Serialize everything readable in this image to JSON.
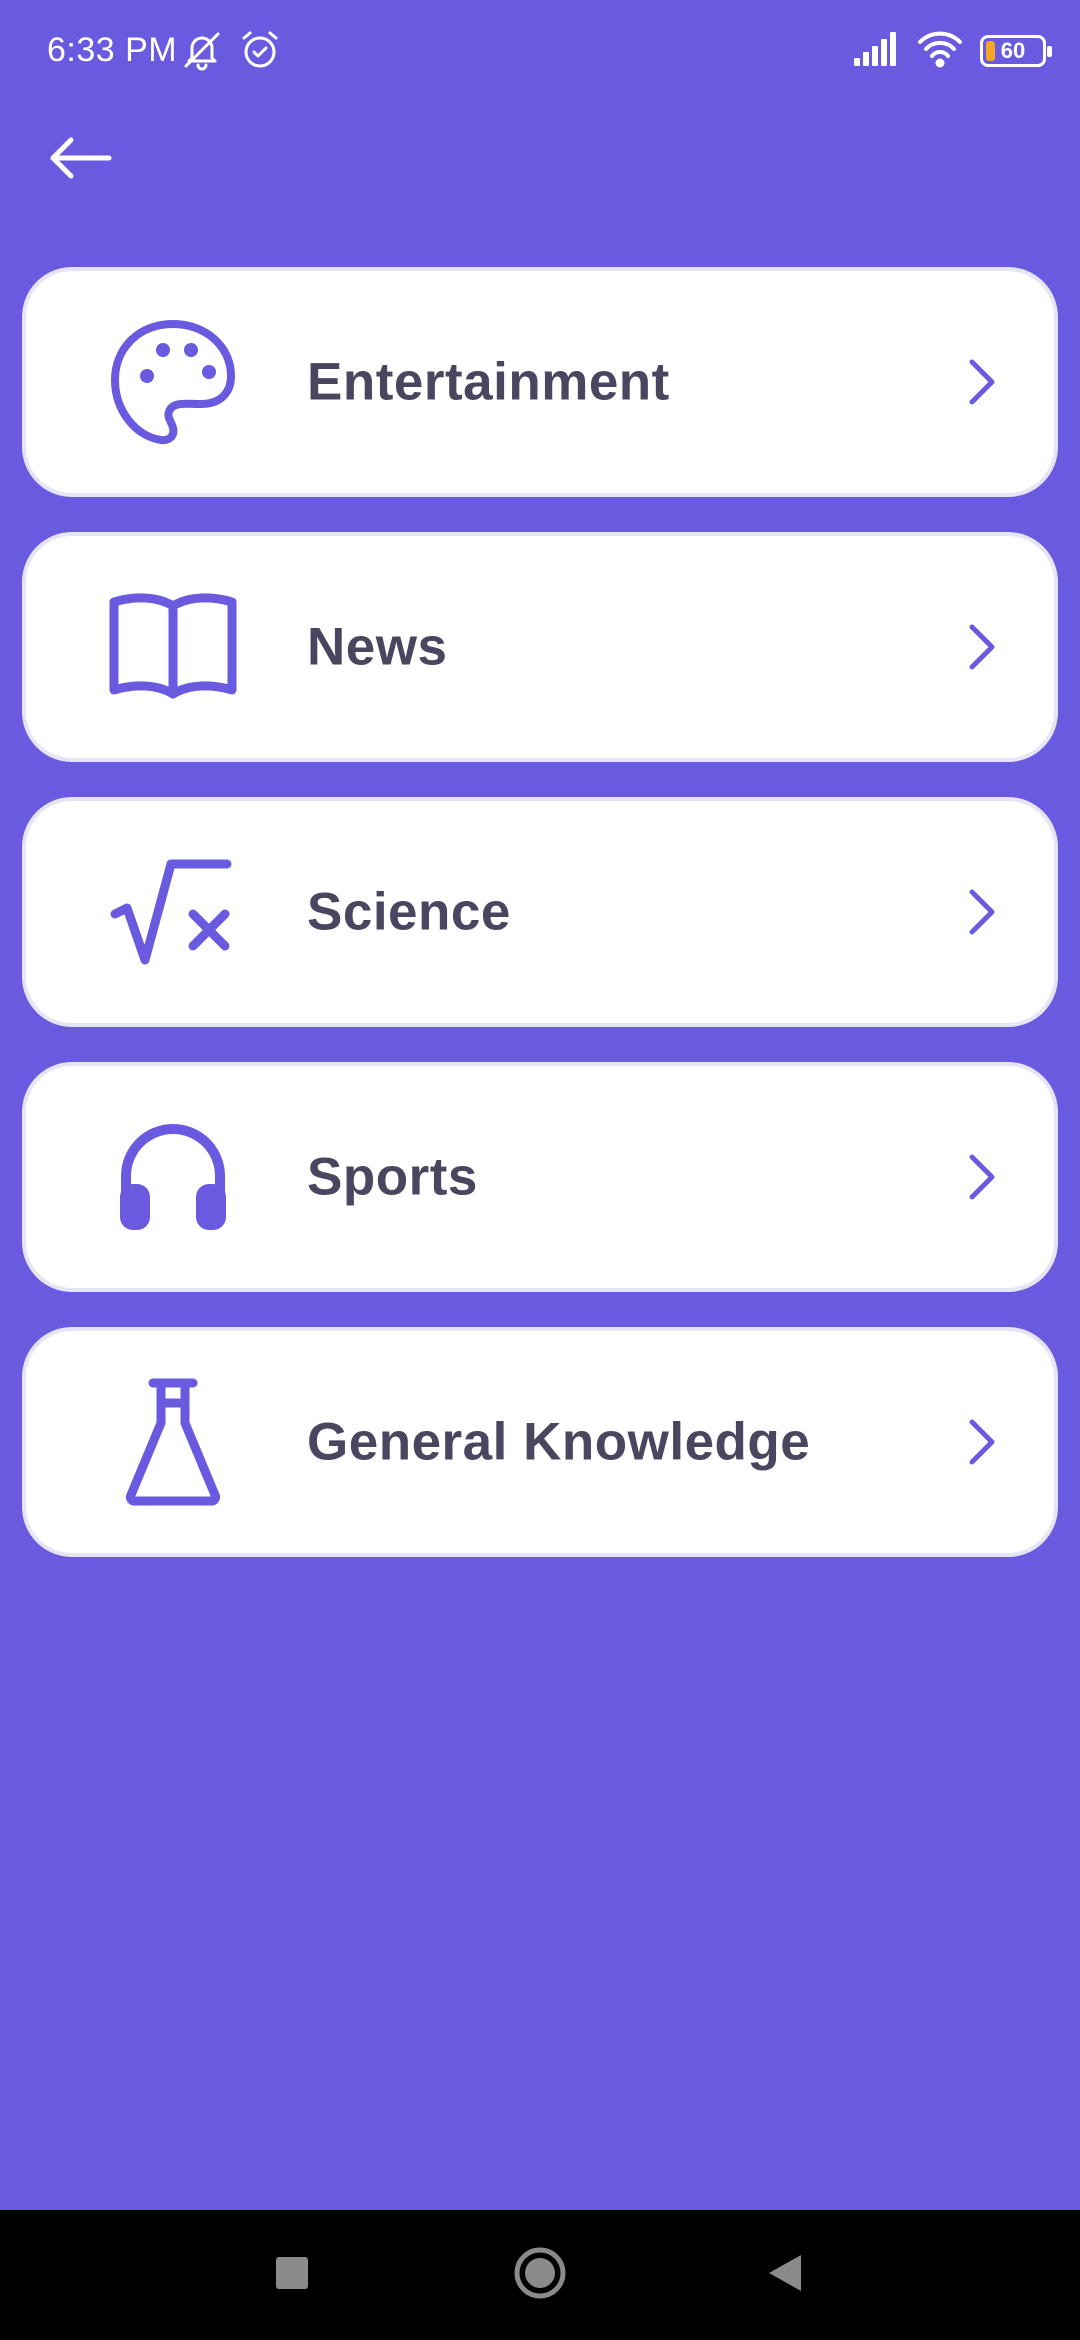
{
  "status_bar": {
    "time": "6:33 PM",
    "battery_level": "60",
    "icons": [
      "mute-icon",
      "alarm-icon",
      "signal-icon",
      "wifi-icon",
      "battery-icon"
    ]
  },
  "header": {
    "back_icon": "arrow-left-icon"
  },
  "categories": [
    {
      "label": "Entertainment",
      "icon": "palette-icon"
    },
    {
      "label": "News",
      "icon": "open-book-icon"
    },
    {
      "label": "Science",
      "icon": "square-root-icon"
    },
    {
      "label": "Sports",
      "icon": "headphones-icon"
    },
    {
      "label": "General Knowledge",
      "icon": "flask-icon"
    }
  ],
  "nav_bar": {
    "buttons": [
      "recents-square-icon",
      "home-circle-icon",
      "back-triangle-icon"
    ]
  },
  "colors": {
    "background": "#6A5AE0",
    "card": "#FFFFFF",
    "accent": "#6A5AE0",
    "text": "#49465F",
    "battery_fill": "#F5A623"
  }
}
